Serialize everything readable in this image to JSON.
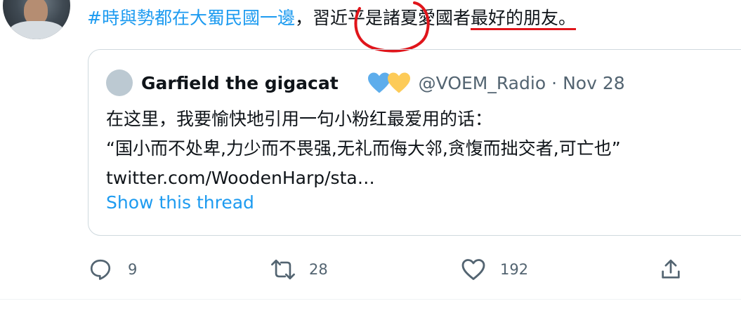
{
  "tweet": {
    "hashtag": "#時與勢都在大蜀民國一邊",
    "separator": "，",
    "text_a": "習近平是諸夏愛國者",
    "text_b": "最好的朋友",
    "text_c": "。"
  },
  "annotations": {
    "mark_color": "#e0151b"
  },
  "quote": {
    "author_name": "Garfield the gigacat",
    "badges": [
      "blue-heart-icon",
      "yellow-heart-icon"
    ],
    "handle": "@VOEM_Radio",
    "dot": "·",
    "date": "Nov 28",
    "line1": "在这里，我要愉快地引用一句小粉红最爱用的话：",
    "line2": "“国小而不处卑,力少而不畏强,无礼而侮大邻,贪愎而拙交者,可亡也”",
    "line3": "twitter.com/WoodenHarp/sta…",
    "show_thread": "Show this thread"
  },
  "actions": {
    "replies": "9",
    "retweets": "28",
    "likes": "192"
  },
  "colors": {
    "accent": "#1d9bf0",
    "muted": "#536471",
    "border": "#cfd9de"
  }
}
